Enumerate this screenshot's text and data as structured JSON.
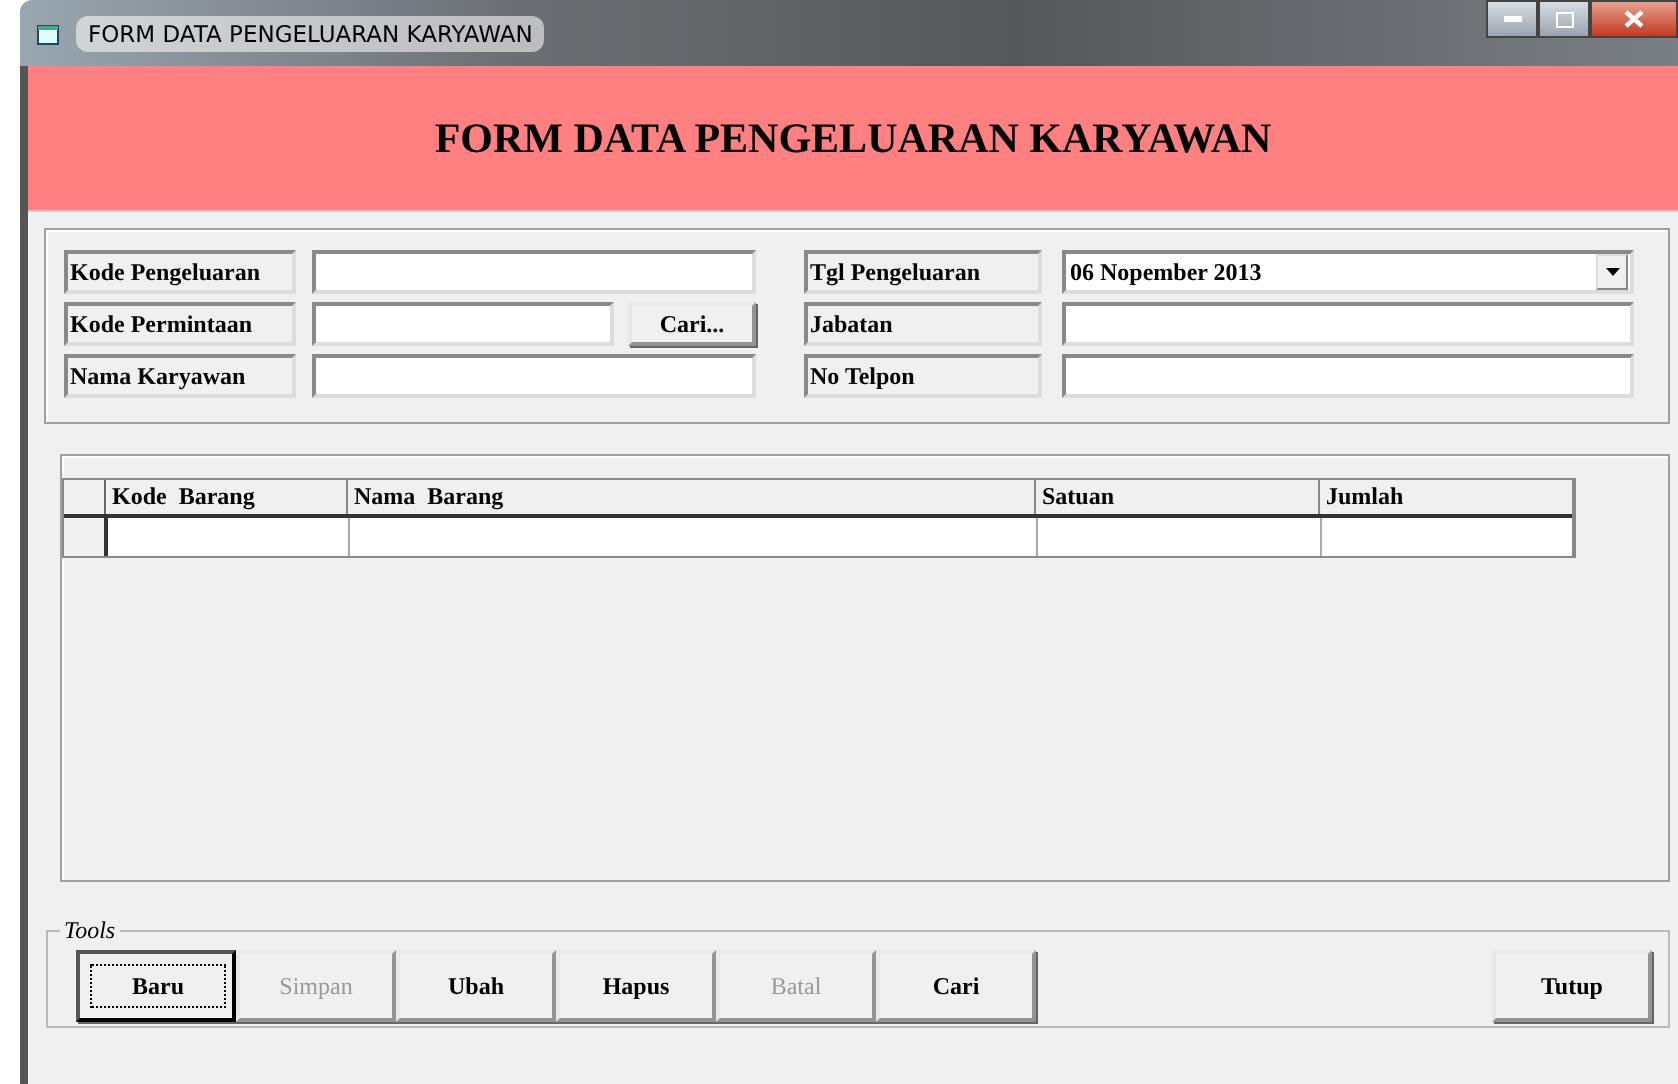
{
  "window": {
    "title": "FORM DATA PENGELUARAN KARYAWAN"
  },
  "header": {
    "title": "FORM DATA PENGELUARAN KARYAWAN"
  },
  "left_fields": [
    {
      "label": "Kode Pengeluaran",
      "kind": "text"
    },
    {
      "label": "Kode Permintaan",
      "kind": "text-button",
      "button": "Cari..."
    },
    {
      "label": "Nama Karyawan",
      "kind": "text"
    }
  ],
  "right_fields": [
    {
      "label": "Tgl Pengeluaran",
      "kind": "dropdown",
      "value": "06 Nopember 2013"
    },
    {
      "label": "Jabatan",
      "kind": "text"
    },
    {
      "label": "No Telpon",
      "kind": "text"
    }
  ],
  "table": {
    "columns": [
      "Kode  Barang",
      "Nama  Barang",
      "Satuan",
      "Jumlah"
    ]
  },
  "tools": {
    "title": "Tools",
    "buttons": [
      {
        "label": "Baru",
        "disabled": false,
        "focused": true
      },
      {
        "label": "Simpan",
        "disabled": true,
        "focused": false
      },
      {
        "label": "Ubah",
        "disabled": false,
        "focused": false
      },
      {
        "label": "Hapus",
        "disabled": false,
        "focused": false
      },
      {
        "label": "Batal",
        "disabled": true,
        "focused": false
      },
      {
        "label": "Cari",
        "disabled": false,
        "focused": false
      }
    ],
    "close_button": "Tutup"
  }
}
